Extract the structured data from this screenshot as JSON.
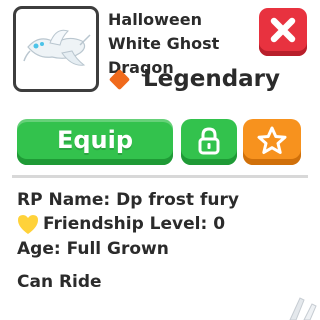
{
  "pet": {
    "name": "Halloween White Ghost Dragon",
    "rarity": "Legendary",
    "rarity_color": "#f06a1c"
  },
  "actions": {
    "equip_label": "Equip",
    "close_icon": "close-icon",
    "lock_icon": "lock-icon",
    "favorite_icon": "star-icon"
  },
  "details": {
    "rp_name": "RP Name: Dp frost fury",
    "friendship": "Friendship Level: 0",
    "age": "Age: Full Grown",
    "ride": "Can Ride"
  },
  "colors": {
    "green": "#33c24d",
    "red": "#e8323f",
    "orange": "#f7921e",
    "heart": "#ffd23a"
  }
}
